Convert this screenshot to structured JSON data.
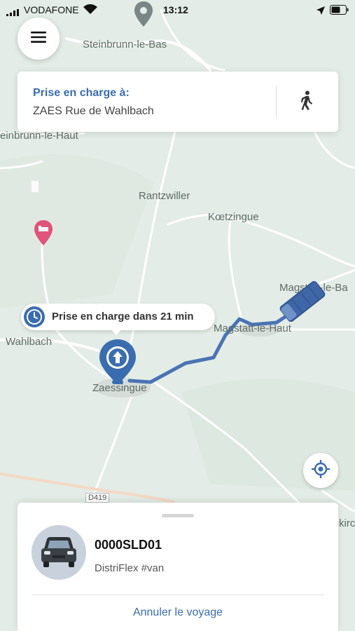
{
  "status_bar": {
    "carrier": "VODAFONE",
    "time": "13:12"
  },
  "map": {
    "labels": {
      "steinbrunn_bas": "Steinbrunn-le-Bas",
      "steinbrunn_haut": "einbrunn-le-Haut",
      "rantzwiller": "Rantzwiller",
      "koetzingue": "Kœtzingue",
      "magstatt_bas": "Magstatt-le-Ba",
      "magstatt_haut": "Magstatt-le-Haut",
      "wahlbach": "Wahlbach",
      "zaessingue": "Zaessingue",
      "road_d419": "D419",
      "kirch": "kirc"
    },
    "route_color": "#4a73b5",
    "marker_color": "#3a6cb0"
  },
  "pickup": {
    "title": "Prise en charge à:",
    "address": "ZAES Rue de Wahlbach"
  },
  "eta": {
    "text": "Prise en charge dans 21 min"
  },
  "trip": {
    "vehicle_id": "0000SLD01",
    "vehicle_type": "DistriFlex #van",
    "cancel_label": "Annuler le voyage"
  },
  "icons": {
    "menu": "hamburger-menu-icon",
    "walk": "walking-person-icon",
    "clock": "clock-icon",
    "locate": "crosshair-icon",
    "pickup": "pickup-pin-icon",
    "hotel": "hotel-pin-icon",
    "poi": "location-pin-icon",
    "vehicle": "van-icon"
  }
}
